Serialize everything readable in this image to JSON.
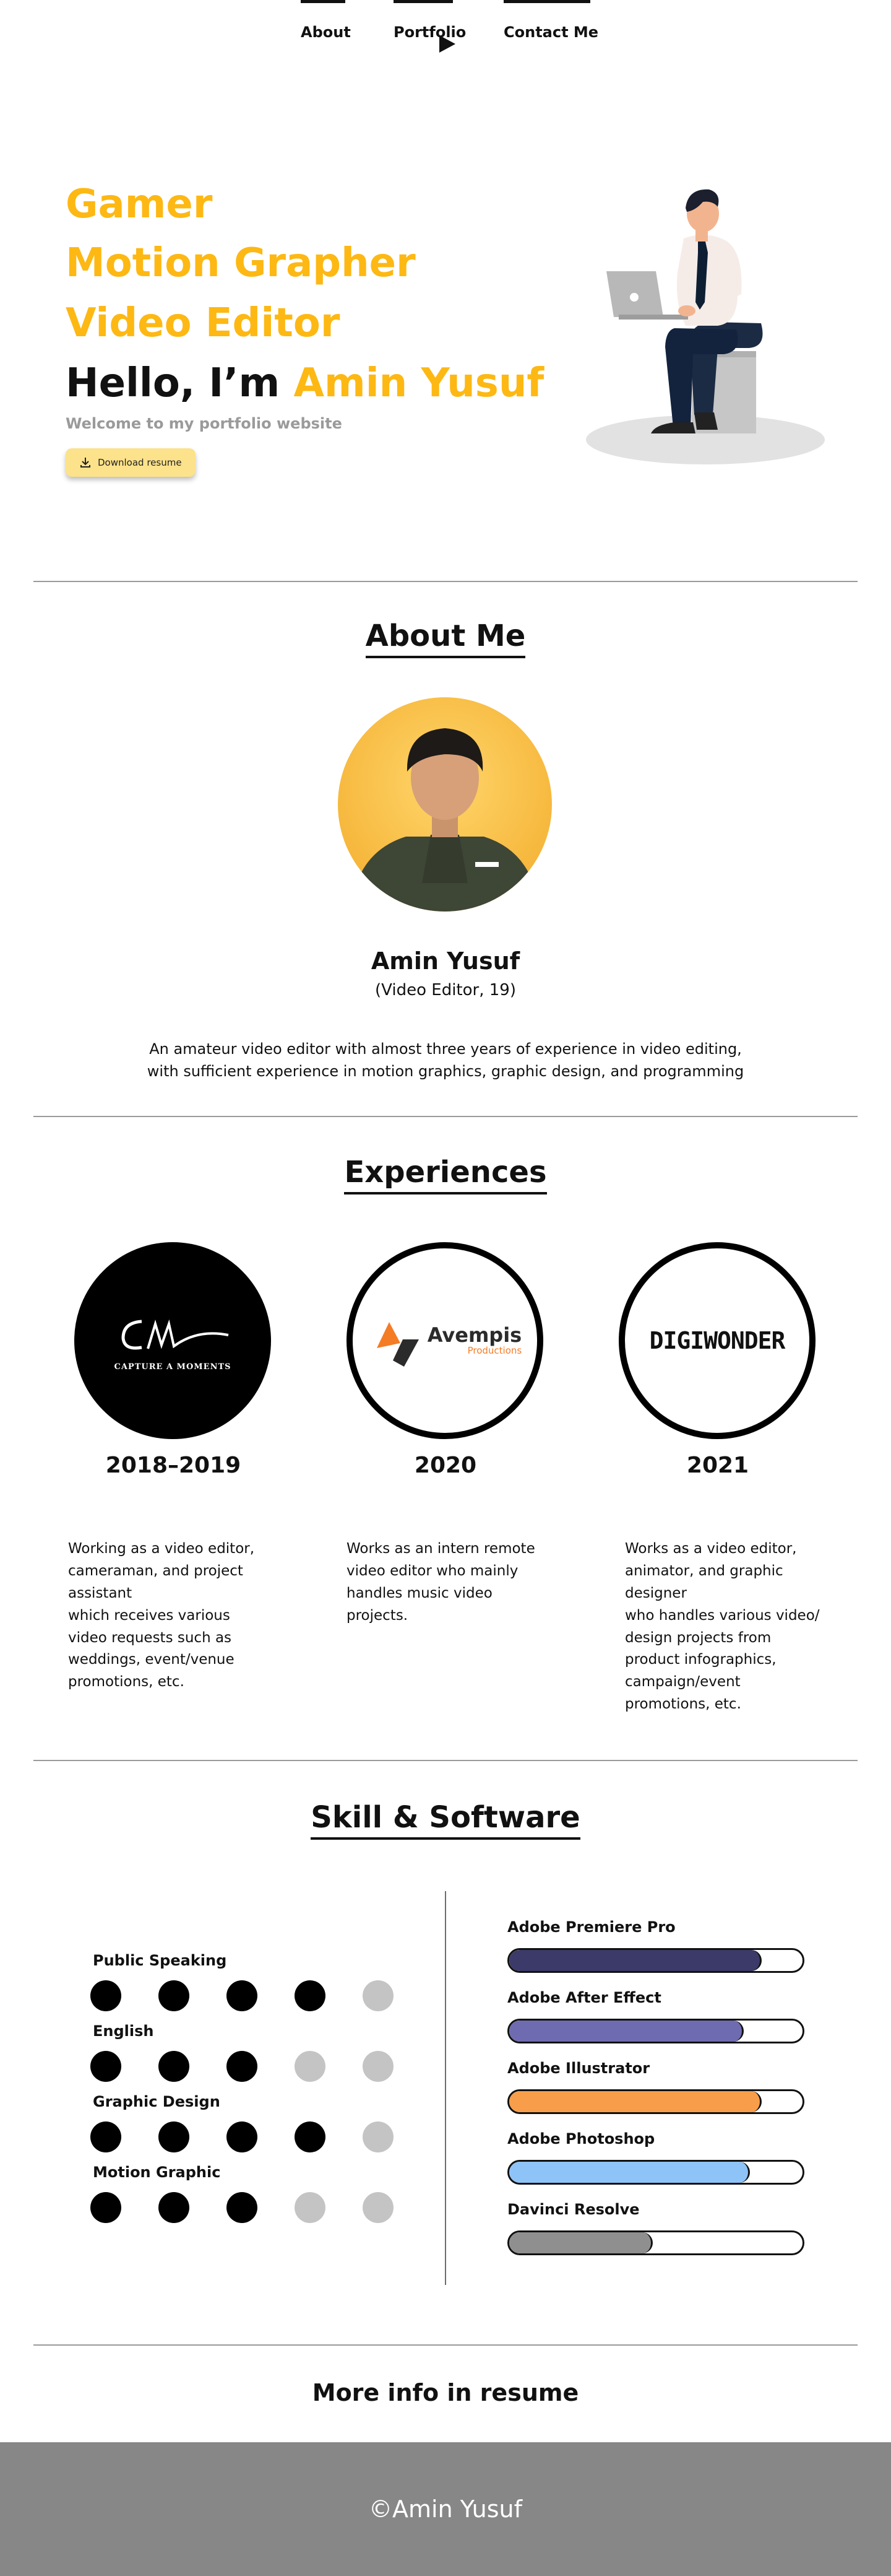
{
  "nav": {
    "items": [
      {
        "label": "About"
      },
      {
        "label": "Portfolio"
      },
      {
        "label": "Contact Me"
      }
    ]
  },
  "hero": {
    "line1": "Gamer",
    "line2": "Motion Grapher",
    "line3": "Video Editor",
    "greeting": "Hello, I’m ",
    "name": "Amin Yusuf",
    "welcome": "Welcome to my portfolio website",
    "download_label": "Download resume"
  },
  "about": {
    "title": "About Me",
    "name": "Amin Yusuf",
    "subtitle": "(Video Editor, 19)",
    "desc_line1": "An amateur video editor with almost three years of experience in video editing,",
    "desc_line2": "with sufficient experience in motion graphics, graphic design, and programming"
  },
  "experiences": {
    "title": "Experiences",
    "items": [
      {
        "logo_text": "CAPTURE A MOMENTS",
        "logo_mark": "CM",
        "year": "2018–2019",
        "desc": [
          "Working as a video editor,",
          "cameraman, and project",
          "assistant",
          "which receives various",
          "video requests such as",
          "weddings, event/venue",
          "promotions, etc."
        ]
      },
      {
        "logo_text": "Avempis",
        "logo_sub": "Productions",
        "year": "2020",
        "desc": [
          "Works as an intern remote",
          "video editor who mainly",
          "handles music video",
          "projects."
        ]
      },
      {
        "logo_text": "DIGIWONDER",
        "year": "2021",
        "desc": [
          "Works as a video editor,",
          "animator, and graphic",
          "designer",
          "who handles various video/",
          "design projects from",
          "product infographics,",
          "campaign/event",
          "promotions, etc."
        ]
      }
    ]
  },
  "skills": {
    "title": "Skill & Software",
    "skill_items": [
      {
        "label": "Public Speaking",
        "level": 4,
        "max": 5
      },
      {
        "label": "English",
        "level": 3,
        "max": 5
      },
      {
        "label": "Graphic Design",
        "level": 4,
        "max": 5
      },
      {
        "label": "Motion Graphic",
        "level": 3,
        "max": 5
      }
    ],
    "software_items": [
      {
        "label": "Adobe Premiere Pro",
        "level": 0.86,
        "color": "#3B3A68"
      },
      {
        "label": "Adobe After Effect",
        "level": 0.8,
        "color": "#6F6BB0"
      },
      {
        "label": "Adobe Illustrator",
        "level": 0.86,
        "color": "#F89E4A"
      },
      {
        "label": "Adobe Photoshop",
        "level": 0.82,
        "color": "#8EC3F7"
      },
      {
        "label": "Davinci Resolve",
        "level": 0.49,
        "color": "#8F8F8F"
      }
    ]
  },
  "more_info": "More info in resume",
  "footer": "©Amin Yusuf",
  "colors": {
    "accent": "#FDB813",
    "button_bg": "#FCE28A",
    "footer_bg": "#878787"
  }
}
